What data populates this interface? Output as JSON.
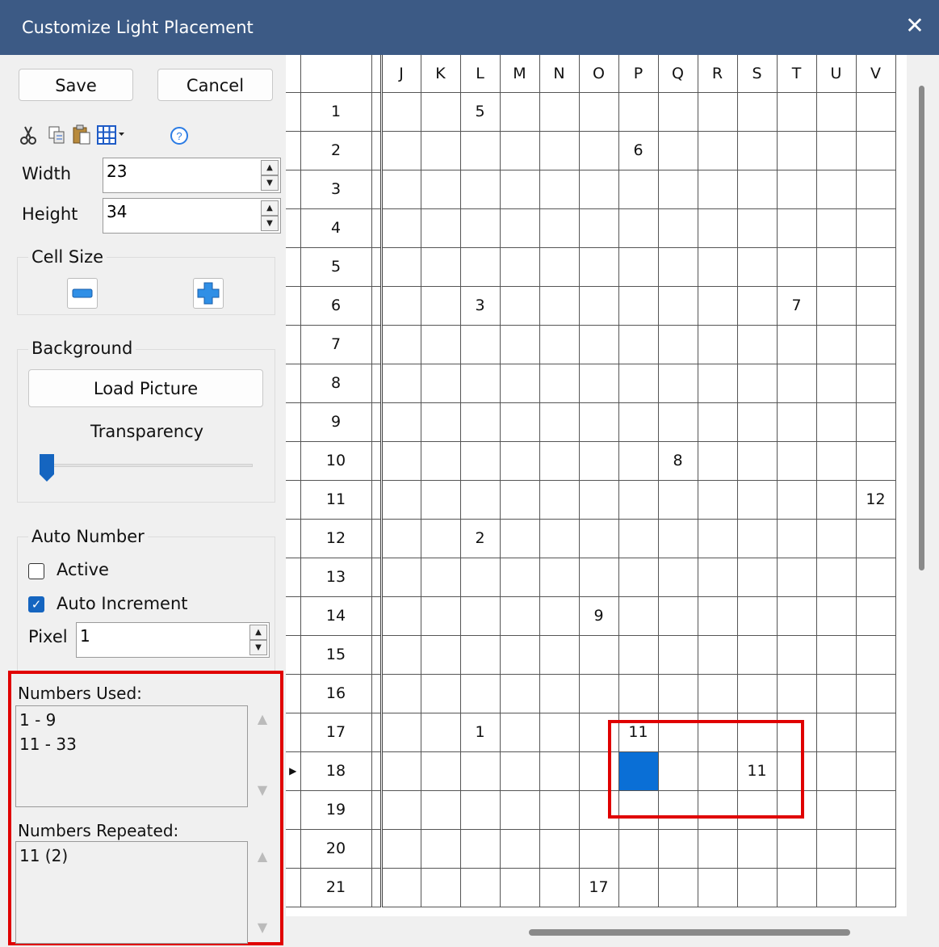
{
  "window": {
    "title": "Customize Light Placement",
    "close_glyph": "✕"
  },
  "buttons": {
    "save": "Save",
    "cancel": "Cancel"
  },
  "toolbar": {
    "icons": [
      "cut-icon",
      "copy-icon",
      "paste-icon",
      "grid-menu-icon",
      "help-icon"
    ]
  },
  "dimensions": {
    "width_label": "Width",
    "width_value": "23",
    "height_label": "Height",
    "height_value": "34"
  },
  "cell_size": {
    "label": "Cell Size"
  },
  "background": {
    "label": "Background",
    "load_picture": "Load Picture",
    "transparency_label": "Transparency",
    "transparency_level": 0
  },
  "auto_number": {
    "label": "Auto Number",
    "active_label": "Active",
    "active_checked": false,
    "auto_increment_label": "Auto Increment",
    "auto_increment_checked": true,
    "pixel_label": "Pixel",
    "pixel_value": "1"
  },
  "numbers_used": {
    "label": "Numbers Used:",
    "items": [
      "1 - 9",
      "11 - 33"
    ]
  },
  "numbers_repeated": {
    "label": "Numbers Repeated:",
    "items": [
      "11 (2)"
    ]
  },
  "grid": {
    "columns": [
      "J",
      "K",
      "L",
      "M",
      "N",
      "O",
      "P",
      "Q",
      "R",
      "S",
      "T",
      "U",
      "V"
    ],
    "rows": [
      {
        "label": "1",
        "cells": {
          "L": "5"
        }
      },
      {
        "label": "2",
        "cells": {
          "P": "6"
        }
      },
      {
        "label": "3",
        "cells": {}
      },
      {
        "label": "4",
        "cells": {}
      },
      {
        "label": "5",
        "cells": {}
      },
      {
        "label": "6",
        "cells": {
          "L": "3",
          "T": "7"
        }
      },
      {
        "label": "7",
        "cells": {}
      },
      {
        "label": "8",
        "cells": {}
      },
      {
        "label": "9",
        "cells": {}
      },
      {
        "label": "10",
        "cells": {
          "Q": "8"
        }
      },
      {
        "label": "11",
        "cells": {
          "V": "12"
        }
      },
      {
        "label": "12",
        "cells": {
          "L": "2"
        }
      },
      {
        "label": "13",
        "cells": {}
      },
      {
        "label": "14",
        "cells": {
          "O": "9"
        }
      },
      {
        "label": "15",
        "cells": {}
      },
      {
        "label": "16",
        "cells": {}
      },
      {
        "label": "17",
        "cells": {
          "L": "1",
          "P": "11"
        }
      },
      {
        "label": "18",
        "cells": {
          "S": "11"
        },
        "current": true,
        "selected": "P"
      },
      {
        "label": "19",
        "cells": {}
      },
      {
        "label": "20",
        "cells": {}
      },
      {
        "label": "21",
        "cells": {
          "O": "17"
        }
      }
    ]
  },
  "colors": {
    "title_bar": "#3c5a85",
    "selection": "#0a6fd6",
    "highlight": "#e00000"
  }
}
